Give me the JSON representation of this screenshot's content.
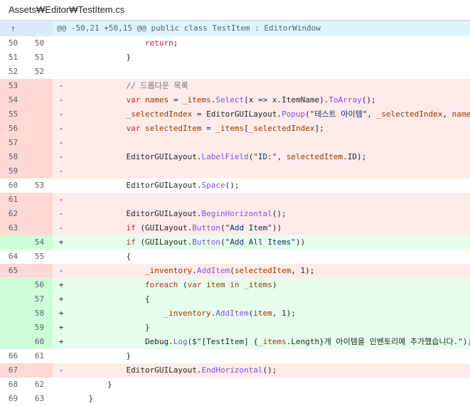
{
  "file_path": "Assets₩Editor₩TestItem.cs",
  "hunk_header": "@@ -50,21 +50,15 @@ public class TestItem : EditorWindow",
  "lines": [
    {
      "type": "ctx",
      "old": "50",
      "new": "50",
      "sign": "",
      "code": "                return;"
    },
    {
      "type": "ctx",
      "old": "51",
      "new": "51",
      "sign": "",
      "code": "            }"
    },
    {
      "type": "ctx",
      "old": "52",
      "new": "52",
      "sign": "",
      "code": ""
    },
    {
      "type": "del",
      "old": "53",
      "new": "",
      "sign": "-",
      "code": "            // 드롭다운 목록"
    },
    {
      "type": "del",
      "old": "54",
      "new": "",
      "sign": "-",
      "code": "            var names = _items.Select(x => x.ItemName).ToArray();"
    },
    {
      "type": "del",
      "old": "55",
      "new": "",
      "sign": "-",
      "code": "            _selectedIndex = EditorGUILayout.Popup(\"테스트 아이템\", _selectedIndex, names);"
    },
    {
      "type": "del",
      "old": "56",
      "new": "",
      "sign": "-",
      "code": "            var selectedItem = _items[_selectedIndex];"
    },
    {
      "type": "del",
      "old": "57",
      "new": "",
      "sign": "-",
      "code": ""
    },
    {
      "type": "del",
      "old": "58",
      "new": "",
      "sign": "-",
      "code": "            EditorGUILayout.LabelField(\"ID:\", selectedItem.ID);"
    },
    {
      "type": "del",
      "old": "59",
      "new": "",
      "sign": "-",
      "code": ""
    },
    {
      "type": "ctx",
      "old": "60",
      "new": "53",
      "sign": "",
      "code": "            EditorGUILayout.Space();"
    },
    {
      "type": "del",
      "old": "61",
      "new": "",
      "sign": "-",
      "code": ""
    },
    {
      "type": "del",
      "old": "62",
      "new": "",
      "sign": "-",
      "code": "            EditorGUILayout.BeginHorizontal();"
    },
    {
      "type": "del",
      "old": "63",
      "new": "",
      "sign": "-",
      "code": "            if (GUILayout.Button(\"Add Item\"))"
    },
    {
      "type": "add",
      "old": "",
      "new": "54",
      "sign": "+",
      "code": "            if (GUILayout.Button(\"Add All Items\"))"
    },
    {
      "type": "ctx",
      "old": "64",
      "new": "55",
      "sign": "",
      "code": "            {"
    },
    {
      "type": "del",
      "old": "65",
      "new": "",
      "sign": "-",
      "code": "                _inventory.AddItem(selectedItem, 1);"
    },
    {
      "type": "add",
      "old": "",
      "new": "56",
      "sign": "+",
      "code": "                foreach (var item in _items)"
    },
    {
      "type": "add",
      "old": "",
      "new": "57",
      "sign": "+",
      "code": "                {"
    },
    {
      "type": "add",
      "old": "",
      "new": "58",
      "sign": "+",
      "code": "                    _inventory.AddItem(item, 1);"
    },
    {
      "type": "add",
      "old": "",
      "new": "59",
      "sign": "+",
      "code": "                }"
    },
    {
      "type": "add",
      "old": "",
      "new": "60",
      "sign": "+",
      "code": "                Debug.Log($\"[TestItem] {_items.Length}개 아이템을 인벤토리에 추가했습니다.\");"
    },
    {
      "type": "ctx",
      "old": "66",
      "new": "61",
      "sign": "",
      "code": "            }"
    },
    {
      "type": "del",
      "old": "67",
      "new": "",
      "sign": "-",
      "code": "            EditorGUILayout.EndHorizontal();"
    },
    {
      "type": "ctx",
      "old": "68",
      "new": "62",
      "sign": "",
      "code": "        }"
    },
    {
      "type": "ctx",
      "old": "69",
      "new": "63",
      "sign": "",
      "code": "    }"
    }
  ]
}
